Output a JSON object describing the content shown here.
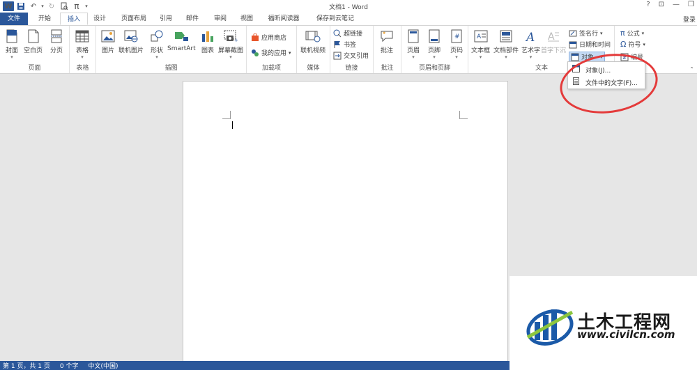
{
  "window": {
    "title": "文档1 - Word",
    "login": "登录",
    "qat_pi": "π"
  },
  "tabs": [
    "文件",
    "开始",
    "插入",
    "设计",
    "页面布局",
    "引用",
    "邮件",
    "审阅",
    "视图",
    "福昕阅读器",
    "保存到云笔记"
  ],
  "active_tab": "插入",
  "ribbon": {
    "groups": {
      "pages": "页面",
      "tables": "表格",
      "illustrations": "插图",
      "addins": "加载项",
      "media": "媒体",
      "links": "链接",
      "comments": "批注",
      "header_footer": "页眉和页脚",
      "text": "文本"
    },
    "buttons": {
      "cover": "封面",
      "blank": "空白页",
      "pagebreak": "分页",
      "table": "表格",
      "picture": "图片",
      "online_picture": "联机图片",
      "shapes": "形状",
      "smartart": "SmartArt",
      "chart": "图表",
      "screenshot": "屏幕截图",
      "store": "应用商店",
      "myapps": "我的应用",
      "online_video": "联机视频",
      "hyperlink": "超链接",
      "bookmark": "书签",
      "crossref": "交叉引用",
      "comment": "批注",
      "header": "页眉",
      "footer": "页脚",
      "pagenum": "页码",
      "textbox": "文本框",
      "quickparts": "文档部件",
      "wordart": "艺术字",
      "dropcap": "首字下沉",
      "signature": "签名行",
      "datetime": "日期和时间",
      "object": "对象",
      "equation": "公式",
      "symbol": "符号",
      "number": "编号"
    }
  },
  "object_menu": {
    "items": [
      "对象(J)...",
      "文件中的文字(F)..."
    ]
  },
  "status": {
    "page": "第 1 页，共 1 页",
    "words": "0 个字",
    "lang": "中文(中国)"
  },
  "watermark": {
    "title": "土木工程网",
    "url": "www.civilcn.com"
  },
  "colors": {
    "accent": "#2b579a",
    "annotation": "#e43a3a"
  }
}
